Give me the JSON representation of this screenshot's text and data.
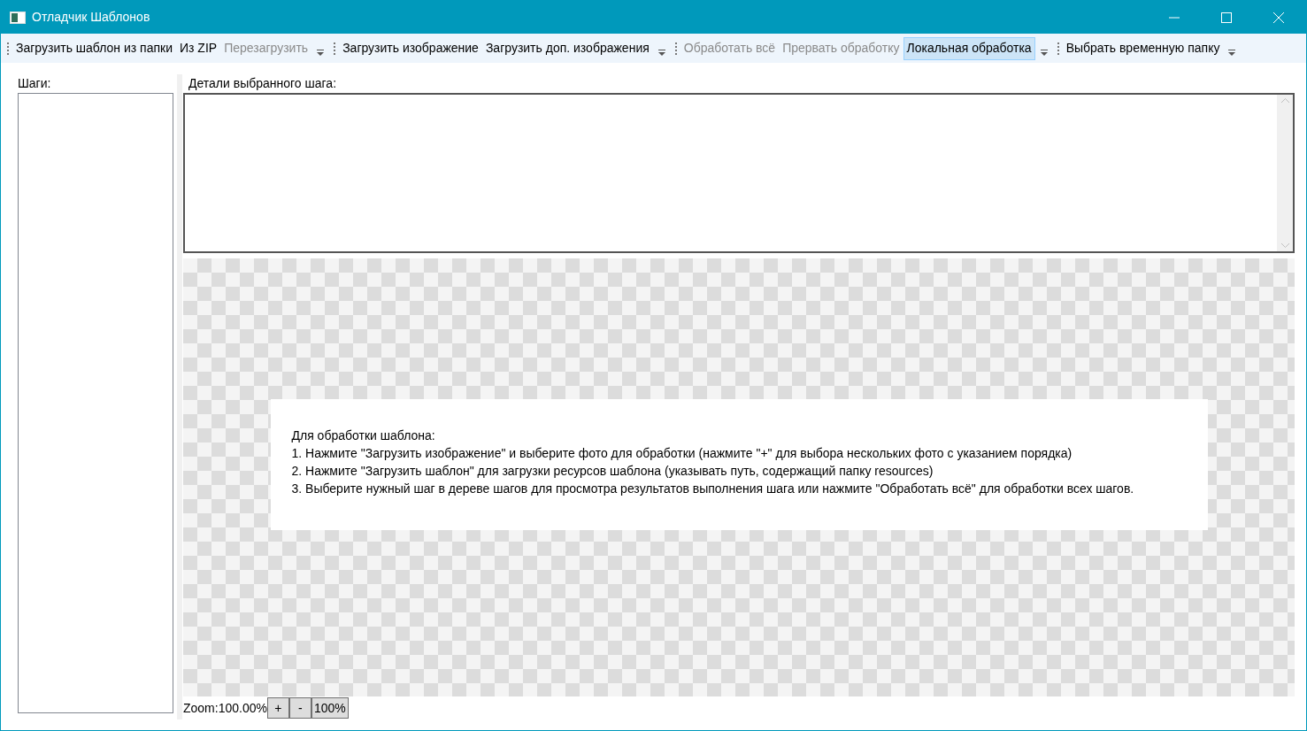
{
  "window": {
    "title": "Отладчик Шаблонов"
  },
  "toolbar": [
    {
      "items": [
        {
          "label": "Загрузить шаблон из папки",
          "disabled": false,
          "selected": false
        },
        {
          "label": "Из ZIP",
          "disabled": false,
          "selected": false
        },
        {
          "label": "Перезагрузить",
          "disabled": true,
          "selected": false
        }
      ]
    },
    {
      "items": [
        {
          "label": "Загрузить изображение",
          "disabled": false,
          "selected": false
        },
        {
          "label": "Загрузить доп. изображения",
          "disabled": false,
          "selected": false
        }
      ]
    },
    {
      "items": [
        {
          "label": "Обработать всё",
          "disabled": true,
          "selected": false
        },
        {
          "label": "Прервать обработку",
          "disabled": true,
          "selected": false
        },
        {
          "label": "Локальная обработка",
          "disabled": false,
          "selected": true
        }
      ]
    },
    {
      "items": [
        {
          "label": "Выбрать временную папку",
          "disabled": false,
          "selected": false
        }
      ]
    }
  ],
  "steps": {
    "label": "Шаги:"
  },
  "details": {
    "label": "Детали выбранного шага:"
  },
  "message": [
    "Для обработки шаблона:",
    "1. Нажмите \"Загрузить изображение\" и выберите фото для обработки (нажмите \"+\" для выбора нескольких фото с указанием порядка)",
    "2. Нажмите \"Загрузить шаблон\" для загрузки ресурсов шаблона (указывать путь, содержащий папку resources)",
    "3. Выберите нужный шаг в дереве шагов для просмотра результатов выполнения шага или нажмите \"Обработать всё\" для обработки всех шагов."
  ],
  "zoom": {
    "label": "Zoom:100.00%",
    "buttons": [
      "+",
      "-",
      "100%"
    ]
  }
}
